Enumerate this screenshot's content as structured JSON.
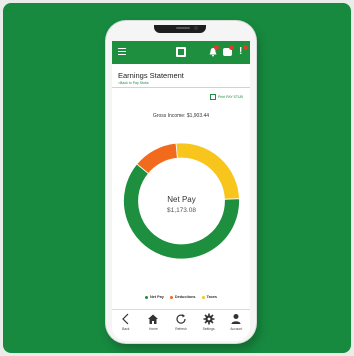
{
  "colors": {
    "background_green": "#178a3f",
    "net_pay": "#1d8f3f",
    "deductions": "#f26a1b",
    "taxes": "#f7c51c"
  },
  "app": {
    "header_icons": [
      "menu-icon",
      "logo-icon",
      "bell-icon",
      "chat-icon",
      "alert-icon"
    ]
  },
  "page": {
    "title": "Earnings Statement",
    "back_link": "<Back to Pay Stubs",
    "print_link": "Print PAY STUB",
    "gross_income": "Gross Income: $1,903.44"
  },
  "chart_data": {
    "type": "pie",
    "donut": true,
    "categories": [
      "Net Pay",
      "Deductions",
      "Taxes"
    ],
    "values": [
      1173.08,
      238.0,
      492.36
    ],
    "center_title": "Net Pay",
    "center_value": "$1,173.08",
    "legend_position": "bottom"
  },
  "legend": [
    {
      "label": "Net Pay",
      "color": "#1d8f3f"
    },
    {
      "label": "Deductions",
      "color": "#f26a1b"
    },
    {
      "label": "Taxes",
      "color": "#f7c51c"
    }
  ],
  "bottom_nav": [
    {
      "label": "Back",
      "icon": "chevron-left-icon"
    },
    {
      "label": "Home",
      "icon": "home-icon"
    },
    {
      "label": "Refresh",
      "icon": "refresh-icon"
    },
    {
      "label": "Settings",
      "icon": "gear-icon"
    },
    {
      "label": "Account",
      "icon": "person-icon"
    }
  ]
}
